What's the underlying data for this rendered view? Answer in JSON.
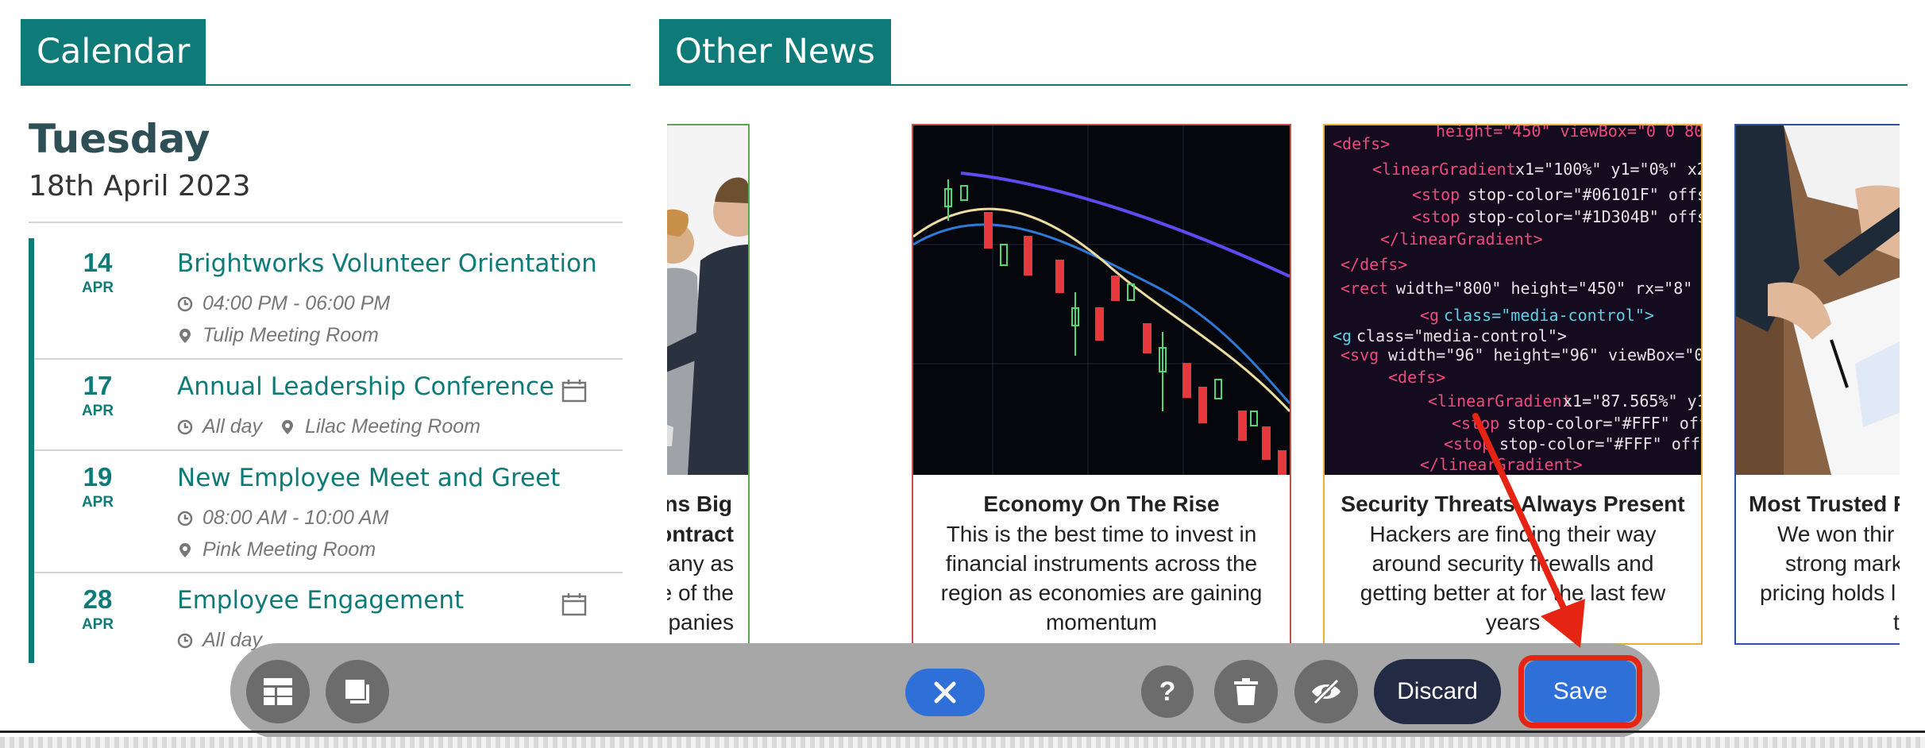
{
  "calendar": {
    "heading": "Calendar",
    "day": "Tuesday",
    "date": "18th April 2023",
    "events": [
      {
        "day": "14",
        "month": "APR",
        "title": "Brightworks Volunteer Orientation",
        "time": "04:00 PM - 06:00 PM",
        "location": "Tulip Meeting Room"
      },
      {
        "day": "17",
        "month": "APR",
        "title": "Annual Leadership Conference",
        "time": "All day",
        "location": "Lilac Meeting Room"
      },
      {
        "day": "19",
        "month": "APR",
        "title": "New Employee Meet and Greet",
        "time": "08:00 AM - 10:00 AM",
        "location": "Pink Meeting Room"
      },
      {
        "day": "28",
        "month": "APR",
        "title": "Employee Engagement",
        "time": "All day",
        "location": ""
      }
    ]
  },
  "news": {
    "heading": "Other News",
    "cards": [
      {
        "title": "urance Wins Big",
        "title2": "ontract",
        "desc_lines": [
          "for the company as",
          "rust of one of the",
          ": companies"
        ],
        "border_color": "#5aa84e"
      },
      {
        "title": "Economy On The Rise",
        "desc_lines": [
          "This is the best time to invest in",
          "financial instruments across the",
          "region as economies are gaining",
          "momentum"
        ],
        "border_color": "#c0504d"
      },
      {
        "title": "Security Threats Always Present",
        "desc_lines": [
          "Hackers are finding their way",
          "around security firewalls and",
          "getting better at for the last few",
          "years"
        ],
        "border_color": "#e8b23a"
      },
      {
        "title": "Most Trusted F",
        "desc_lines": [
          "We won thir",
          "strong mark",
          "pricing holds l",
          "t"
        ],
        "border_color": "#2f4fa8"
      }
    ]
  },
  "toolbar": {
    "discard_label": "Discard",
    "save_label": "Save"
  },
  "colors": {
    "teal": "#0f7b78",
    "save_blue": "#2f6fd8",
    "discard_navy": "#222a44",
    "annotation_red": "#e52414"
  }
}
